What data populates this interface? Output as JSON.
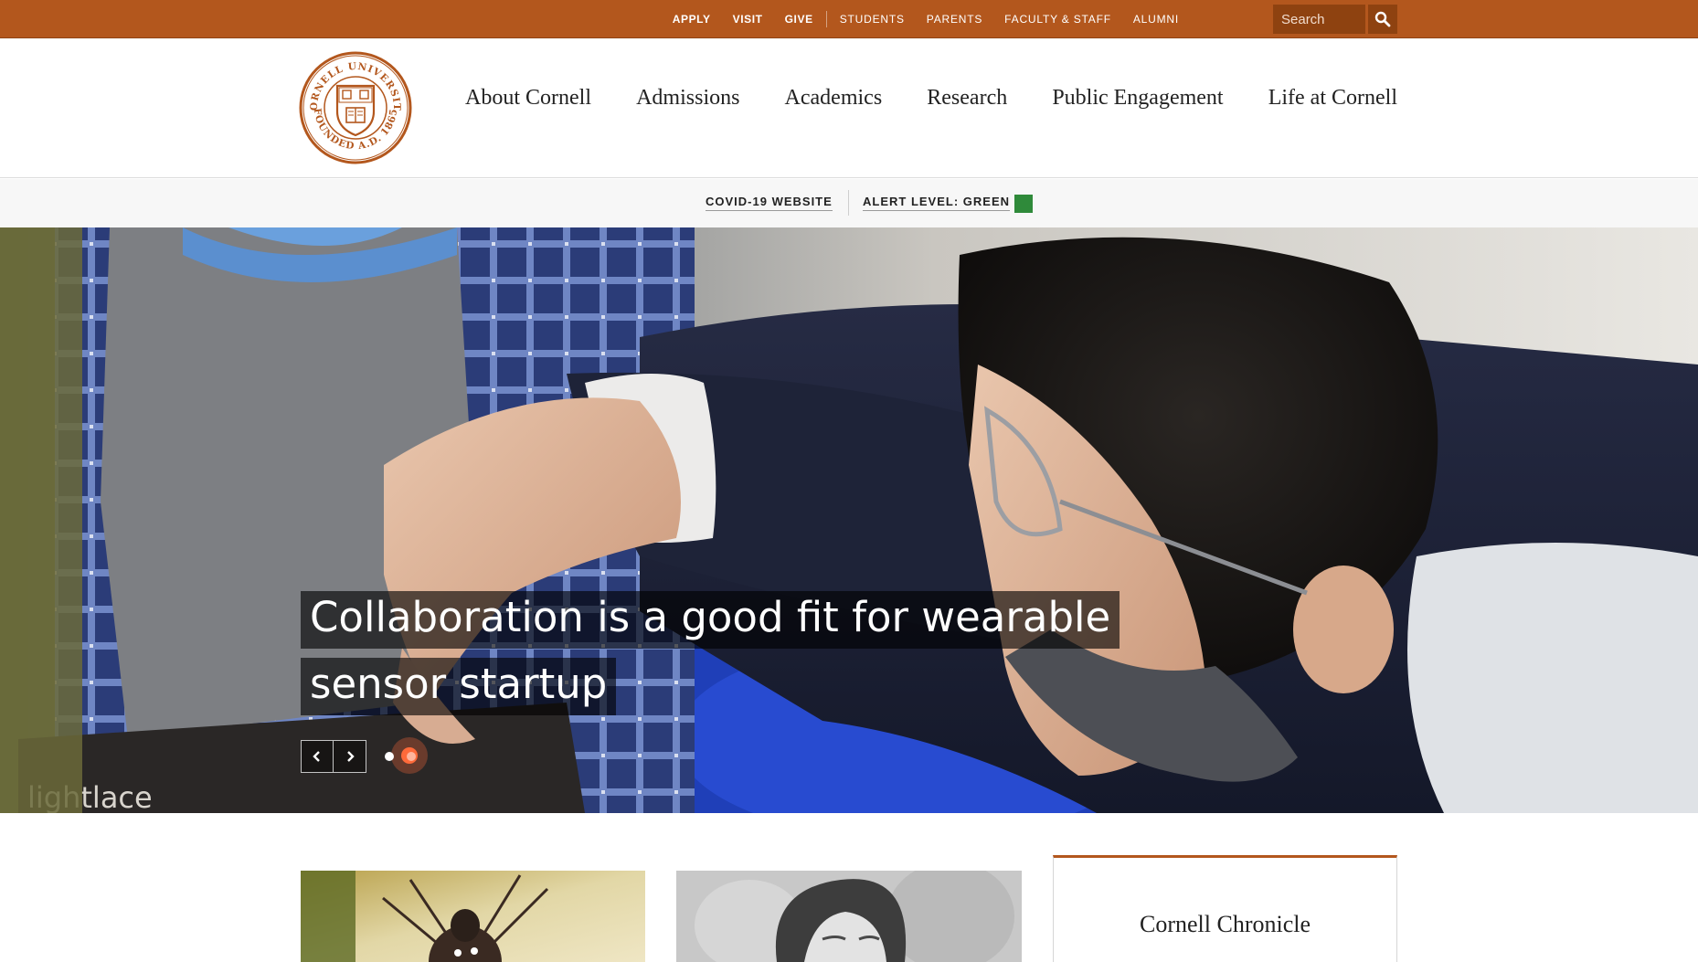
{
  "utility": {
    "links": [
      "APPLY",
      "VISIT",
      "GIVE"
    ],
    "audience_links": [
      "STUDENTS",
      "PARENTS",
      "FACULTY & STAFF",
      "ALUMNI"
    ],
    "search_placeholder": "Search",
    "search_icon": "magnifier-icon"
  },
  "header": {
    "logo_text_top": "CORNELL UNIVERSITY",
    "logo_text_bottom": "FOUNDED A.D. 1865",
    "nav": [
      "About Cornell",
      "Admissions",
      "Academics",
      "Research",
      "Public Engagement",
      "Life at Cornell"
    ]
  },
  "alert": {
    "covid_link": "COVID-19 WEBSITE",
    "alert_link": "ALERT LEVEL: GREEN",
    "alert_color": "#2f8a3a"
  },
  "hero": {
    "caption_line1": "Collaboration is a good fit for wearable",
    "caption_line2": "sensor startup",
    "photo_text": "lightlace",
    "prev_icon": "chevron-left-icon",
    "next_icon": "chevron-right-icon",
    "slides_total": 2,
    "active_slide": 1
  },
  "cards": {
    "chronicle_title": "Cornell Chronicle"
  },
  "colors": {
    "brand": "#b3571d",
    "brand_dark": "#8e4210",
    "alert_green": "#2f8a3a"
  }
}
